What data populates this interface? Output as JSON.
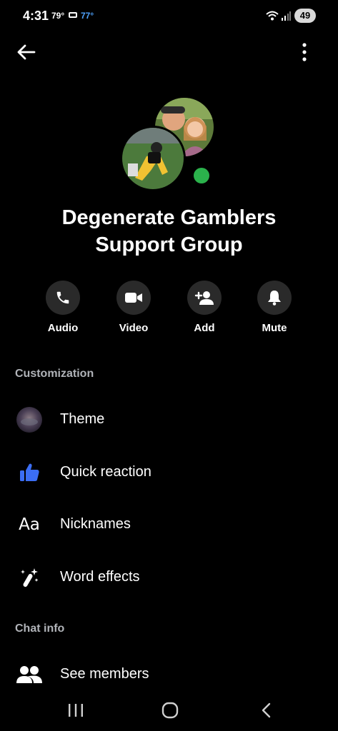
{
  "status_bar": {
    "time": "4:31",
    "temp_left": "79°",
    "temp_right": "77°",
    "battery": "49"
  },
  "header": {
    "title": "Degenerate Gamblers Support Group"
  },
  "actions": [
    {
      "label": "Audio",
      "icon": "phone-icon"
    },
    {
      "label": "Video",
      "icon": "video-icon"
    },
    {
      "label": "Add",
      "icon": "add-person-icon"
    },
    {
      "label": "Mute",
      "icon": "bell-icon"
    }
  ],
  "customization": {
    "header": "Customization",
    "items": [
      {
        "label": "Theme",
        "icon": "theme-icon"
      },
      {
        "label": "Quick reaction",
        "icon": "thumbs-up-icon"
      },
      {
        "label": "Nicknames",
        "icon": "nicknames-icon",
        "glyph": "Aa"
      },
      {
        "label": "Word effects",
        "icon": "word-effects-icon"
      }
    ]
  },
  "chat_info": {
    "header": "Chat info",
    "items": [
      {
        "label": "See members",
        "icon": "members-icon"
      }
    ]
  },
  "colors": {
    "background": "#000000",
    "online": "#2bb24c",
    "reaction_blue": "#3b6ef5",
    "section_gray": "#b0b3b8"
  }
}
